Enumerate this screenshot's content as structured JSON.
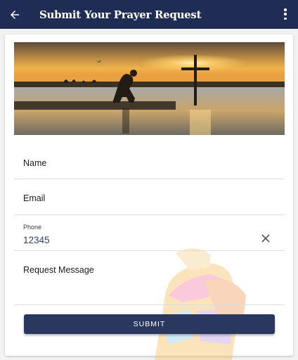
{
  "appbar": {
    "title": "Submit Your Prayer Request",
    "back_icon": "arrow-left-icon",
    "menu_icon": "more-vert-icon",
    "color": "#1f2d55"
  },
  "form": {
    "name_label": "Name",
    "email_label": "Email",
    "phone_label": "Phone",
    "phone_value": "12345",
    "message_label": "Request Message",
    "submit_label": "SUBMIT"
  },
  "colors": {
    "button": "#2a3860",
    "value_text": "#2d3f6a"
  }
}
